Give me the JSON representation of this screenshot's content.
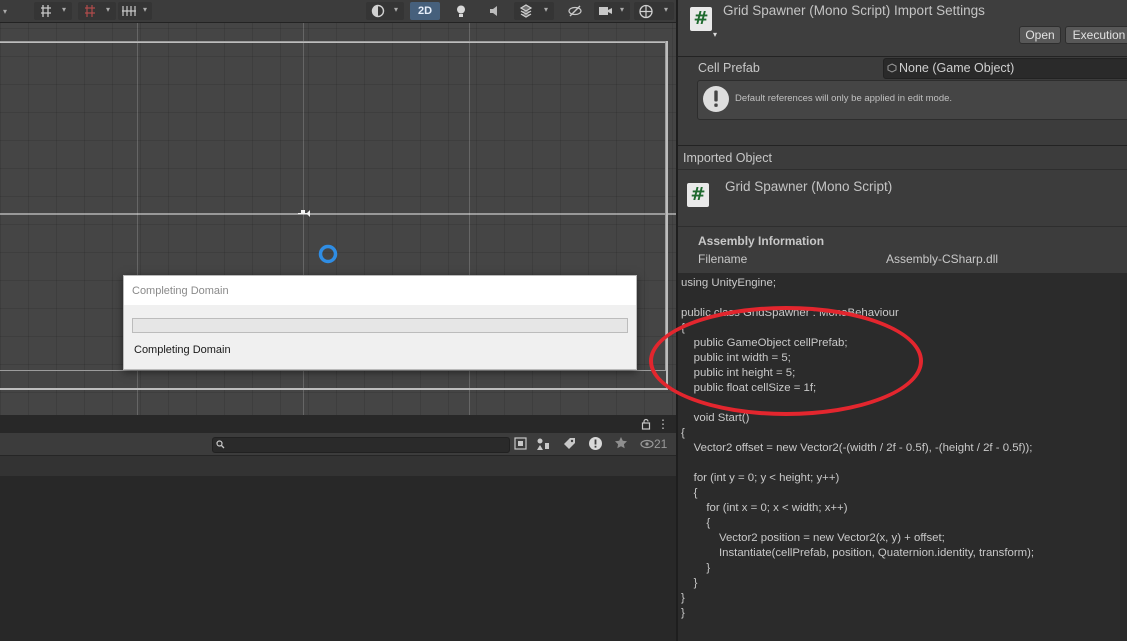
{
  "scene_toolbar": {
    "mode_2d_label": "2D",
    "icons": [
      "grid-snap-icon",
      "grid-visibility-icon",
      "increment-snap-icon",
      "shading-mode-icon",
      "lighting-icon",
      "audio-icon",
      "effects-icon",
      "hidden-objects-icon",
      "camera-icon",
      "gizmos-icon"
    ]
  },
  "dialog": {
    "title": "Completing Domain",
    "status": "Completing Domain"
  },
  "bottom_panel": {
    "hidden_count": "21"
  },
  "inspector": {
    "header_title": "Grid Spawner (Mono Script) Import Settings",
    "open_label": "Open",
    "execution_label": "Execution",
    "cell_prefab_label": "Cell Prefab",
    "cell_prefab_value": "None (Game Object)",
    "help_text": "Default references will only be applied in edit mode.",
    "imported_object_label": "Imported Object",
    "imported_title": "Grid Spawner (Mono Script)",
    "assembly_info_label": "Assembly Information",
    "filename_label": "Filename",
    "filename_value": "Assembly-CSharp.dll"
  },
  "code_lines": [
    "using UnityEngine;",
    "",
    "public class GridSpawner : MonoBehaviour",
    "{",
    "    public GameObject cellPrefab;",
    "    public int width = 5;",
    "    public int height = 5;",
    "    public float cellSize = 1f;",
    "",
    "    void Start()",
    "{",
    "    Vector2 offset = new Vector2(-(width / 2f - 0.5f), -(height / 2f - 0.5f));",
    "",
    "    for (int y = 0; y < height; y++)",
    "    {",
    "        for (int x = 0; x < width; x++)",
    "        {",
    "            Vector2 position = new Vector2(x, y) + offset;",
    "            Instantiate(cellPrefab, position, Quaternion.identity, transform);",
    "        }",
    "    }",
    "}",
    "}"
  ],
  "colors": {
    "annotation_red": "#e3262e",
    "script_icon_green": "#1f6a2f",
    "toolbar_active": "#46607c"
  }
}
